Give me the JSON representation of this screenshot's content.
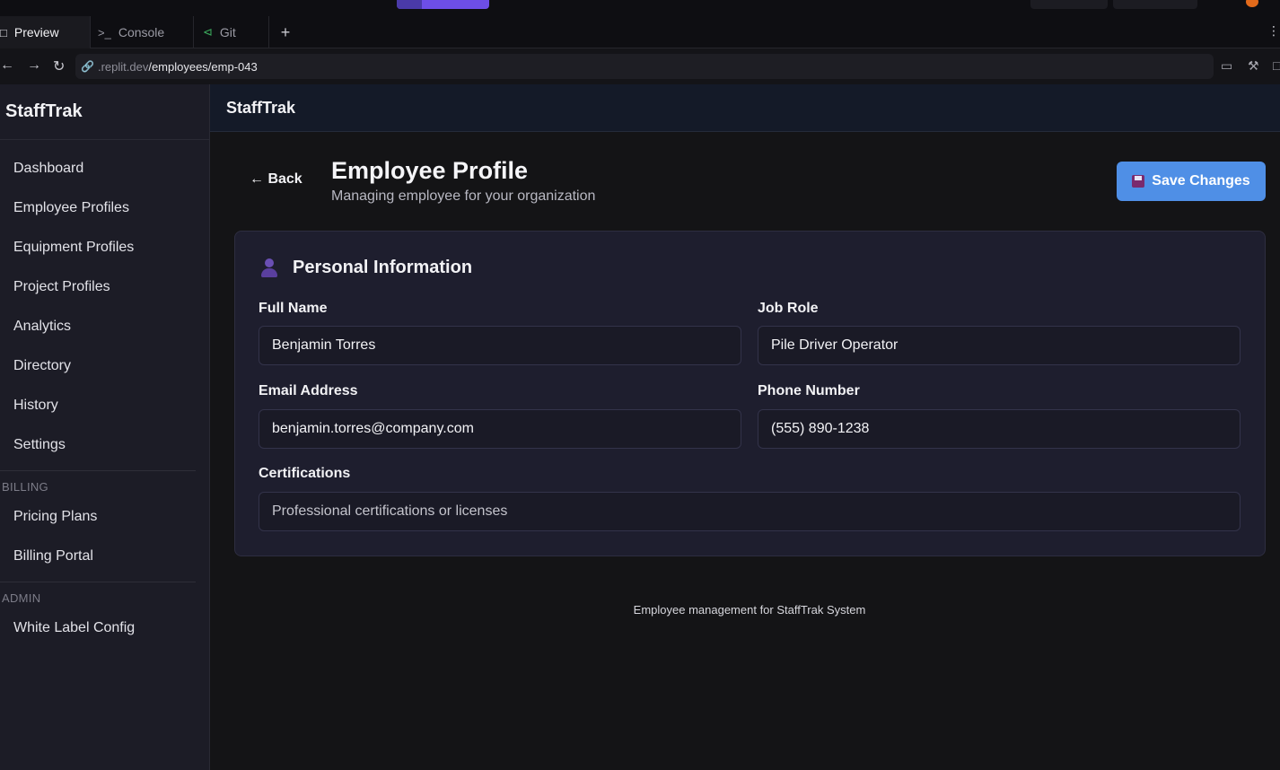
{
  "browser": {
    "tabs": [
      {
        "label": "Preview",
        "icon": "monitor-icon",
        "active": true
      },
      {
        "label": "Console",
        "icon": "terminal-icon",
        "active": false
      },
      {
        "label": "Git",
        "icon": "git-branch-icon",
        "active": false
      }
    ],
    "add_tab_symbol": "+",
    "url_host": ".replit.dev",
    "url_path": "/employees/emp-043"
  },
  "sidebar": {
    "brand": "StaffTrak",
    "items": [
      {
        "label": "Dashboard"
      },
      {
        "label": "Employee Profiles"
      },
      {
        "label": "Equipment Profiles"
      },
      {
        "label": "Project Profiles"
      },
      {
        "label": "Analytics"
      },
      {
        "label": "Directory"
      },
      {
        "label": "History"
      },
      {
        "label": "Settings"
      }
    ],
    "billing_section": "BILLING",
    "billing_items": [
      {
        "label": "Pricing Plans"
      },
      {
        "label": "Billing Portal"
      }
    ],
    "admin_section": "ADMIN",
    "admin_items": [
      {
        "label": "White Label Config"
      }
    ]
  },
  "header": {
    "title": "StaffTrak"
  },
  "page": {
    "back_label": "Back",
    "title": "Employee Profile",
    "subtitle": "Managing employee for your organization",
    "save_label": "Save Changes",
    "footer": "Employee management for StaffTrak System"
  },
  "card": {
    "title": "Personal Information",
    "fields": {
      "full_name": {
        "label": "Full Name",
        "value": "Benjamin Torres"
      },
      "job_role": {
        "label": "Job Role",
        "value": "Pile Driver Operator"
      },
      "email": {
        "label": "Email Address",
        "value": "benjamin.torres@company.com"
      },
      "phone": {
        "label": "Phone Number",
        "value": "(555) 890-1238"
      },
      "certifications": {
        "label": "Certifications",
        "placeholder": "Professional certifications or licenses"
      }
    }
  },
  "colors": {
    "accent": "#4f8fe6",
    "sidebar_bg": "#1c1c26",
    "card_bg": "#1e1e2e"
  }
}
